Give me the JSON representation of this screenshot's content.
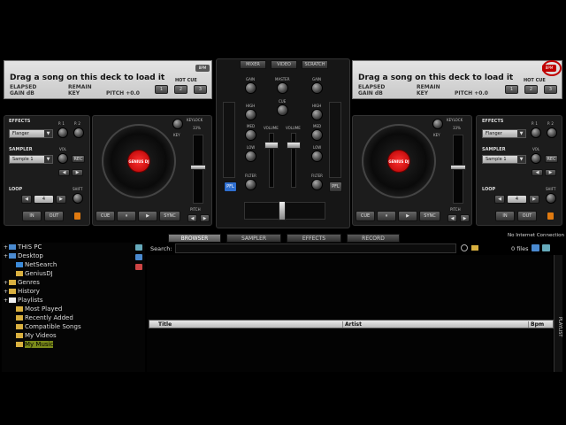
{
  "decks": {
    "left": {
      "title": "Drag a song on this deck to load it",
      "bpm": "BPM",
      "elapsed": "ELAPSED",
      "remain": "REMAIN",
      "gain": "GAIN dB",
      "key": "KEY",
      "pitch": "PITCH +0.0",
      "hot_cue_label": "HOT CUE",
      "hot_cues": [
        "1",
        "2",
        "3"
      ],
      "effects_label": "EFFECTS",
      "effect_value": "Flanger",
      "p1": "P. 1",
      "p2": "P. 2",
      "sampler_label": "SAMPLER",
      "sampler_value": "Sample 1",
      "vol": "VOL",
      "rec": "REC",
      "loop_label": "LOOP",
      "loop_value": "4",
      "shift": "SHIFT",
      "in": "IN",
      "out": "OUT",
      "keylock": "KEYLOCK",
      "keylock_pct": "33%",
      "key_knob": "KEY",
      "pitch_label": "PITCH",
      "cue": "CUE",
      "play_pause": "⏸",
      "play": "▶",
      "sync": "SYNC",
      "logo": "GENIUS DJ"
    },
    "right": {
      "title": "Drag a song on this deck to load it",
      "bpm": "BPM",
      "elapsed": "ELAPSED",
      "remain": "REMAIN",
      "gain": "GAIN dB",
      "key": "KEY",
      "pitch": "PITCH +0.0",
      "hot_cue_label": "HOT CUE",
      "hot_cues": [
        "1",
        "2",
        "3"
      ],
      "effects_label": "EFFECTS",
      "effect_value": "Flanger",
      "p1": "P. 1",
      "p2": "P. 2",
      "sampler_label": "SAMPLER",
      "sampler_value": "Sample 1",
      "vol": "VOL",
      "rec": "REC",
      "loop_label": "LOOP",
      "loop_value": "4",
      "shift": "SHIFT",
      "in": "IN",
      "out": "OUT",
      "keylock": "KEYLOCK",
      "keylock_pct": "33%",
      "key_knob": "KEY",
      "pitch_label": "PITCH",
      "cue": "CUE",
      "play_pause": "⏸",
      "play": "▶",
      "sync": "SYNC",
      "logo": "GENIUS DJ"
    }
  },
  "mixer": {
    "tabs": [
      "MIXER",
      "VIDEO",
      "SCRATCH"
    ],
    "gain": "GAIN",
    "master": "MASTER",
    "cue": "CUE",
    "high": "HIGH",
    "med": "MED",
    "low": "LOW",
    "volume": "VOLUME",
    "filter": "FILTER",
    "pfl": "PFL"
  },
  "browser_tabs": [
    "BROWSER",
    "SAMPLER",
    "EFFECTS",
    "RECORD"
  ],
  "connection_status": "No Internet Connection",
  "search_label": "Search:",
  "files_count": "0 files",
  "side_tab": "PLAYLIST",
  "tree": [
    {
      "label": "THIS PC",
      "expander": "+",
      "indent": 0,
      "icon": "computer-icon"
    },
    {
      "label": "Desktop",
      "expander": "+",
      "indent": 0,
      "icon": "desktop-icon"
    },
    {
      "label": "NetSearch",
      "expander": "",
      "indent": 1,
      "icon": "globe-icon"
    },
    {
      "label": "GeniusDJ",
      "expander": "",
      "indent": 1,
      "icon": "folder-icon"
    },
    {
      "label": "Genres",
      "expander": "+",
      "indent": 0,
      "icon": "folder-icon"
    },
    {
      "label": "History",
      "expander": "+",
      "indent": 0,
      "icon": "folder-icon"
    },
    {
      "label": "Playlists",
      "expander": "+",
      "indent": 0,
      "icon": "file-icon"
    },
    {
      "label": "Most Played",
      "expander": "",
      "indent": 1,
      "icon": "folder-icon"
    },
    {
      "label": "Recently Added",
      "expander": "",
      "indent": 1,
      "icon": "folder-icon"
    },
    {
      "label": "Compatible Songs",
      "expander": "",
      "indent": 1,
      "icon": "folder-icon"
    },
    {
      "label": "My Videos",
      "expander": "",
      "indent": 1,
      "icon": "folder-icon"
    },
    {
      "label": "My Music",
      "expander": "",
      "indent": 1,
      "icon": "folder-icon",
      "selected": true
    }
  ],
  "columns": [
    "Title",
    "Artist",
    "Bpm"
  ],
  "colors": {
    "accent_red": "#d01010",
    "selected_bg": "#7a8a1a",
    "pfl_blue": "#2f6fd0"
  }
}
